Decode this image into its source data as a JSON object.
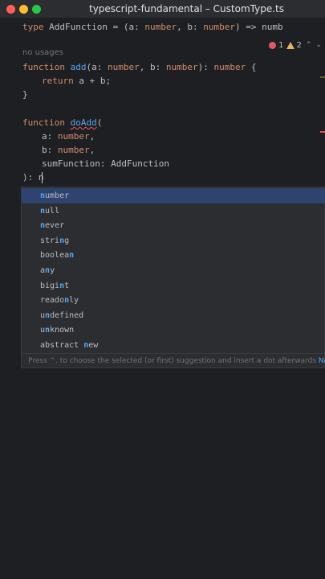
{
  "window": {
    "title": "typescript-fundamental – CustomType.ts"
  },
  "inspections": {
    "errors": "1",
    "warnings": "2"
  },
  "editor": {
    "line1": {
      "kw": "type",
      "rest": " AddFunction = (a: ",
      "t1": "number",
      "mid": ", b: ",
      "t2": "number",
      "end": ") => numb"
    },
    "usage_hint": "no usages",
    "line_add": {
      "kw": "function",
      "name": "add",
      "rest1": "(a: ",
      "t1": "number",
      "rest2": ", b: ",
      "t2": "number",
      "rest3": "): ",
      "t3": "number",
      "rest4": " {"
    },
    "line_return": {
      "kw": "return",
      "rest": " a + b;"
    },
    "line_close": "}",
    "line_doadd": {
      "kw": "function",
      "name": "doAdd",
      "rest": "("
    },
    "line_a": {
      "name": "a: ",
      "type": "number",
      "end": ","
    },
    "line_b": {
      "name": "b: ",
      "type": "number",
      "end": ","
    },
    "line_sum": "sumFunction: AddFunction",
    "line_ret": "): n"
  },
  "completion": {
    "items": [
      {
        "match": "n",
        "rest": "umber"
      },
      {
        "match": "n",
        "rest": "ull"
      },
      {
        "match": "n",
        "rest": "ever"
      },
      {
        "pre": "stri",
        "match": "n",
        "rest": "g"
      },
      {
        "pre": "boolea",
        "match": "n",
        "rest": ""
      },
      {
        "pre": "a",
        "match": "n",
        "rest": "y"
      },
      {
        "pre": "bigi",
        "match": "n",
        "rest": "t"
      },
      {
        "pre": "reado",
        "match": "n",
        "rest": "ly"
      },
      {
        "pre": "u",
        "match": "n",
        "rest": "defined"
      },
      {
        "pre": "u",
        "match": "n",
        "rest": "known"
      },
      {
        "pre": "abstract ",
        "match": "n",
        "rest": "ew"
      }
    ],
    "footer": "Press ^. to choose the selected (or first) suggestion and insert a dot afterwards",
    "footer_link": "Ne"
  },
  "colors": {
    "background": "#1e1f22",
    "keyword": "#cf8e6d",
    "function": "#56a8f5",
    "selection": "#2e436e",
    "error": "#e55765",
    "warning": "#e0b75a"
  }
}
